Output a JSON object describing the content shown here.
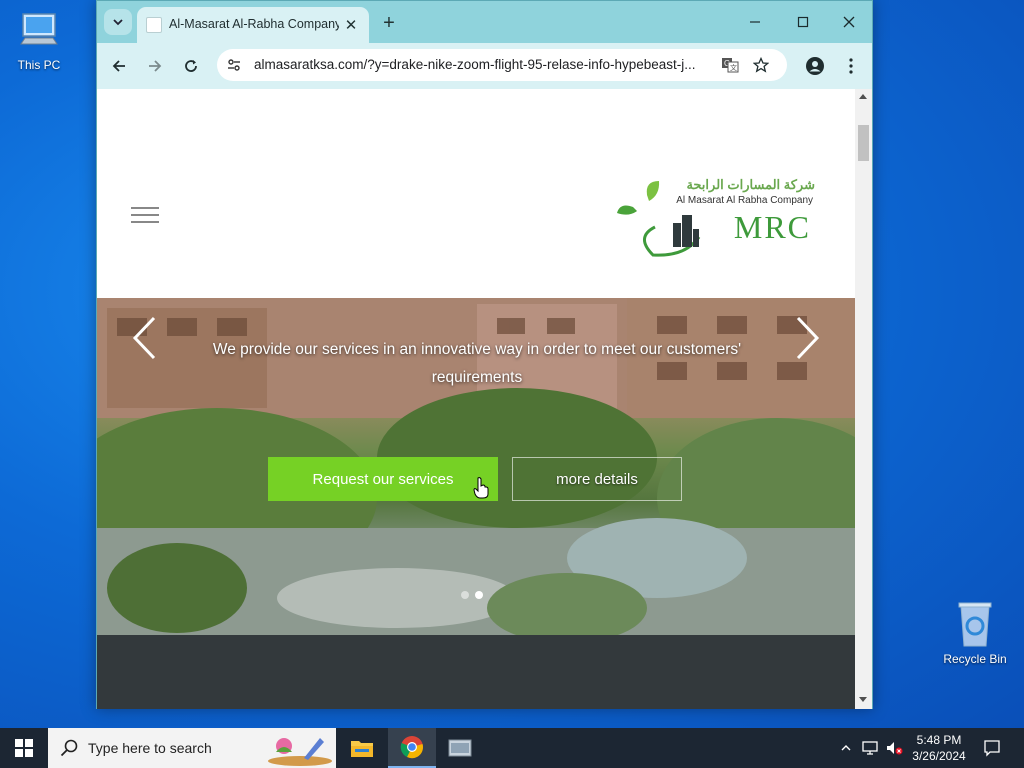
{
  "desktop": {
    "icons": [
      {
        "label": "This PC",
        "icon": "computer-icon"
      },
      {
        "label": "Recycle Bin",
        "icon": "recycle-bin-icon"
      }
    ]
  },
  "browser": {
    "tab": {
      "title": "Al-Masarat Al-Rabha Company",
      "favicon": "site-favicon-icon"
    },
    "url": "almasaratksa.com/?y=drake-nike-zoom-flight-95-relase-info-hypebeast-j...",
    "accent": "#8fd3dc"
  },
  "page": {
    "logo": {
      "arabic": "شركة المسارات الرابحة",
      "english": "Al Masarat Al Rabha Company",
      "mark": "MRC"
    },
    "hero": {
      "tagline": "We provide our services in an innovative way in order to meet our customers' requirements",
      "primary_button": "Request our services",
      "secondary_button": "more details",
      "slide_count": 2,
      "active_slide": 2
    },
    "colors": {
      "brand_green": "#76d125",
      "footer": "#33393c"
    }
  },
  "taskbar": {
    "search_placeholder": "Type here to search",
    "time": "5:48 PM",
    "date": "3/26/2024"
  }
}
